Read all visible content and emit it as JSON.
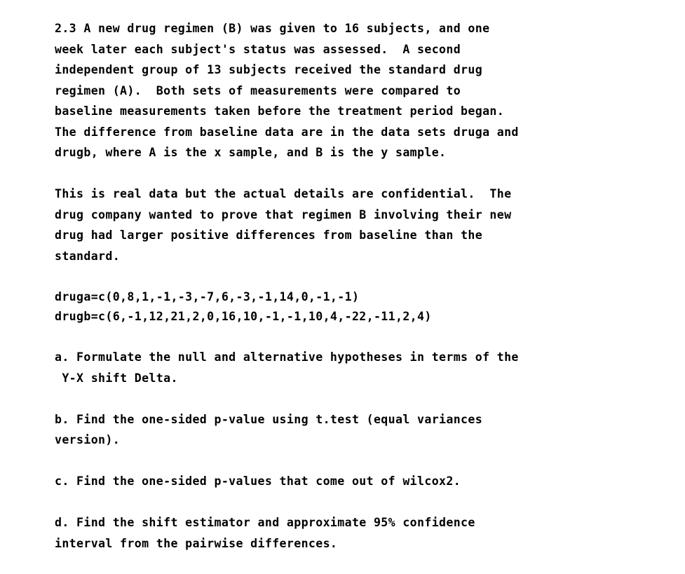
{
  "document": {
    "exercise_number": "2.3",
    "background_color": "#ffffff",
    "text_color": "#000000",
    "paragraphs": {
      "intro": "2.3 A new drug regimen (B) was given to 16 subjects, and one\nweek later each subject's status was assessed.  A second\nindependent group of 13 subjects received the standard drug\nregimen (A).  Both sets of measurements were compared to\nbaseline measurements taken before the treatment period began.\nThe difference from baseline data are in the data sets druga and\ndrugb, where A is the x sample, and B is the y sample.",
      "context": "This is real data but the actual details are confidential.  The\ndrug company wanted to prove that regimen B involving their new\ndrug had larger positive differences from baseline than the\nstandard."
    },
    "code": {
      "druga_line": "druga=c(0,8,1,-1,-3,-7,6,-3,-1,14,0,-1,-1)",
      "drugb_line": "drugb=c(6,-1,12,21,2,0,16,10,-1,-1,10,4,-22,-11,2,4)"
    },
    "data_values": {
      "druga_name": "druga",
      "druga": [
        0,
        8,
        1,
        -1,
        -3,
        -7,
        6,
        -3,
        -1,
        14,
        0,
        -1,
        -1
      ],
      "druga_n": 13,
      "drugb_name": "drugb",
      "drugb": [
        6,
        -1,
        12,
        21,
        2,
        0,
        16,
        10,
        -1,
        -1,
        10,
        4,
        -22,
        -11,
        2,
        4
      ],
      "drugb_n": 16
    },
    "questions": {
      "a": "a. Formulate the null and alternative hypotheses in terms of the\n Y-X shift Delta.",
      "b": "b. Find the one-sided p-value using t.test (equal variances\nversion).",
      "c": "c. Find the one-sided p-values that come out of wilcox2.",
      "d": "d. Find the shift estimator and approximate 95% confidence\ninterval from the pairwise differences."
    }
  }
}
